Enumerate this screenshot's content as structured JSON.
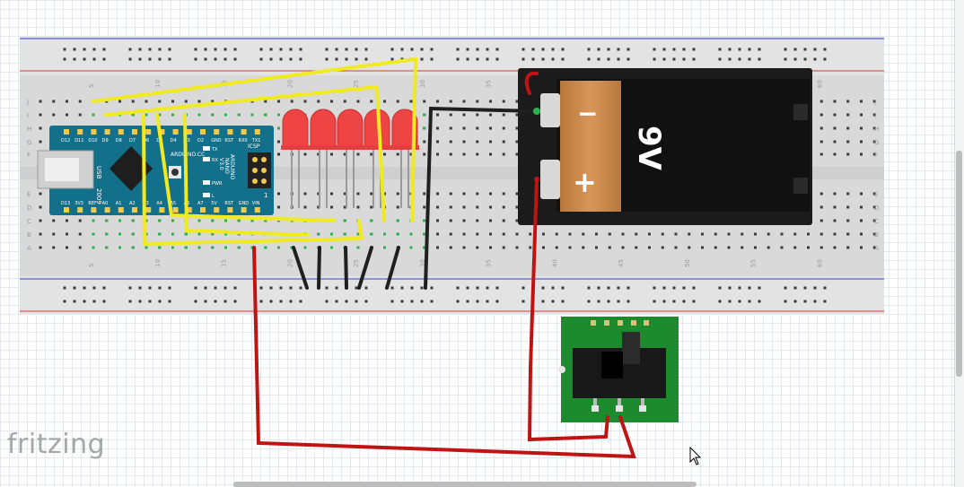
{
  "app": {
    "logo": "fritzing"
  },
  "breadboard": {
    "col_numbers_top": [
      "5",
      "10",
      "15",
      "20",
      "25",
      "30",
      "35",
      "40",
      "45",
      "50",
      "55",
      "60"
    ],
    "col_numbers_bottom": [
      "5",
      "10",
      "15",
      "20",
      "25",
      "30",
      "35",
      "40",
      "45",
      "50",
      "55",
      "60"
    ],
    "rows_top": [
      "J",
      "I",
      "H",
      "G",
      "F"
    ],
    "rows_bottom": [
      "E",
      "D",
      "C",
      "B",
      "A"
    ]
  },
  "arduino": {
    "top_pins": [
      "D12",
      "D11",
      "D10",
      "D9",
      "D8",
      "D7",
      "D6",
      "D5",
      "D4",
      "D3",
      "D2",
      "GND",
      "RST",
      "RX0",
      "TX1"
    ],
    "bottom_pins": [
      "D13",
      "3V3",
      "REF",
      "A0",
      "A1",
      "A2",
      "A3",
      "A4",
      "A5",
      "A6",
      "A7",
      "5V",
      "RST",
      "GND",
      "VIN"
    ],
    "usb_label": "USB",
    "year": "2009",
    "brand": "ARDUINO.CC",
    "model_lines": [
      "ARDUINO",
      "NANO",
      "V3.0"
    ],
    "led_labels": [
      "TX",
      "RX",
      "PWR",
      "L"
    ],
    "icsp": "ICSP",
    "icsp_num": "1"
  },
  "battery": {
    "label": "9V",
    "minus": "−",
    "plus": "+"
  },
  "colors": {
    "wire_yellow": "#f0ea22",
    "wire_black": "#1f1f1f",
    "wire_red": "#c01414",
    "led_red": "#ef4444",
    "pcb_blue": "#13708a",
    "switch_green": "#1d8a2e"
  }
}
